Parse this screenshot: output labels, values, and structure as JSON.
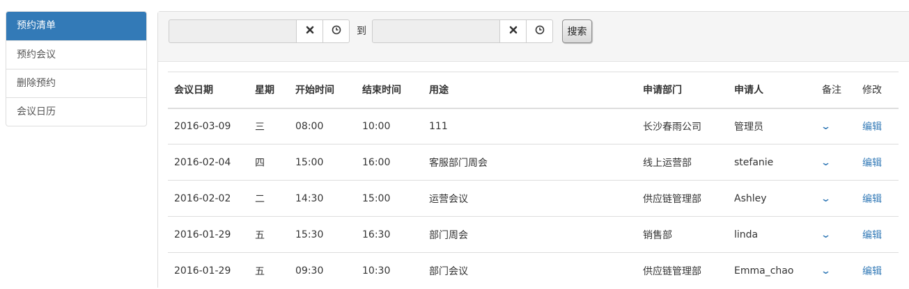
{
  "sidebar": {
    "items": [
      {
        "label": "预约清单",
        "active": true
      },
      {
        "label": "预约会议",
        "active": false
      },
      {
        "label": "删除预约",
        "active": false
      },
      {
        "label": "会议日历",
        "active": false
      }
    ]
  },
  "search": {
    "start_value": "",
    "end_value": "",
    "to_label": "到",
    "search_button": "搜索",
    "clear_icon": "close-icon",
    "time_icon": "clock-icon"
  },
  "table": {
    "headers": [
      "会议日期",
      "星期",
      "开始时间",
      "结束时间",
      "用途",
      "申请部门",
      "申请人",
      "备注",
      "修改"
    ],
    "rows": [
      {
        "date": "2016-03-09",
        "weekday": "三",
        "start": "08:00",
        "end": "10:00",
        "purpose": "111",
        "dept": "长沙春雨公司",
        "applicant": "管理员",
        "edit": "编辑"
      },
      {
        "date": "2016-02-04",
        "weekday": "四",
        "start": "15:00",
        "end": "16:00",
        "purpose": "客服部门周会",
        "dept": "线上运营部",
        "applicant": "stefanie",
        "edit": "编辑"
      },
      {
        "date": "2016-02-02",
        "weekday": "二",
        "start": "14:30",
        "end": "15:00",
        "purpose": "运营会议",
        "dept": "供应链管理部",
        "applicant": "Ashley",
        "edit": "编辑"
      },
      {
        "date": "2016-01-29",
        "weekday": "五",
        "start": "15:30",
        "end": "16:30",
        "purpose": "部门周会",
        "dept": "销售部",
        "applicant": "linda",
        "edit": "编辑"
      },
      {
        "date": "2016-01-29",
        "weekday": "五",
        "start": "09:30",
        "end": "10:30",
        "purpose": "部门会议",
        "dept": "供应链管理部",
        "applicant": "Emma_chao",
        "edit": "编辑"
      }
    ]
  },
  "colors": {
    "primary": "#337ab7",
    "border": "#dddddd",
    "panel_bg": "#f5f5f5"
  }
}
